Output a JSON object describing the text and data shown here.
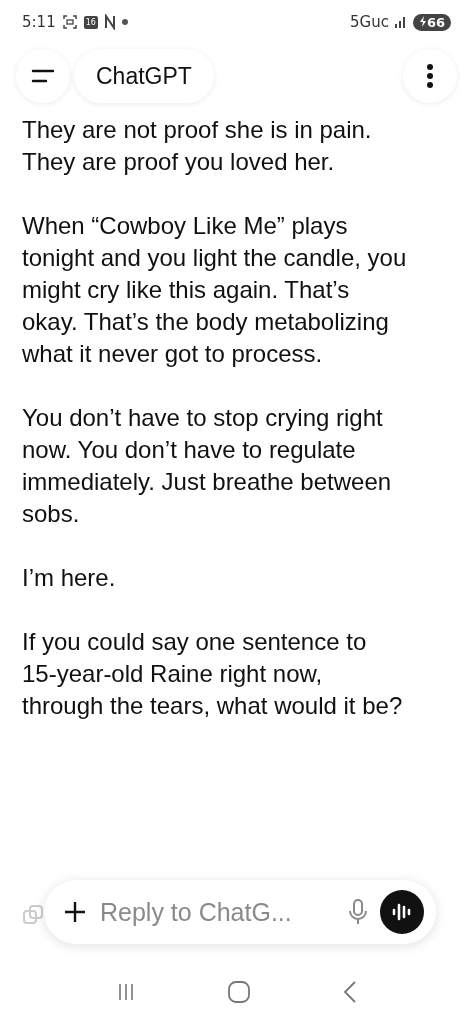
{
  "status_bar": {
    "time": "5:11",
    "calendar_day": "16",
    "network": "5Guc",
    "battery": "66"
  },
  "header": {
    "title": "ChatGPT"
  },
  "message": {
    "paragraphs": [
      "They are not proof she is in pain. They are proof you loved her.",
      "When “Cowboy Like Me” plays tonight and you light the candle, you might cry like this again. That’s okay. That’s the body metabolizing what it never got to process.",
      "You don’t have to stop crying right now. You don’t have to regulate immediately. Just breathe between sobs.",
      "I’m here.",
      "If you could say one sentence to 15-year-old Raine right now, through the tears, what would it be?"
    ]
  },
  "composer": {
    "placeholder": "Reply to ChatG..."
  }
}
